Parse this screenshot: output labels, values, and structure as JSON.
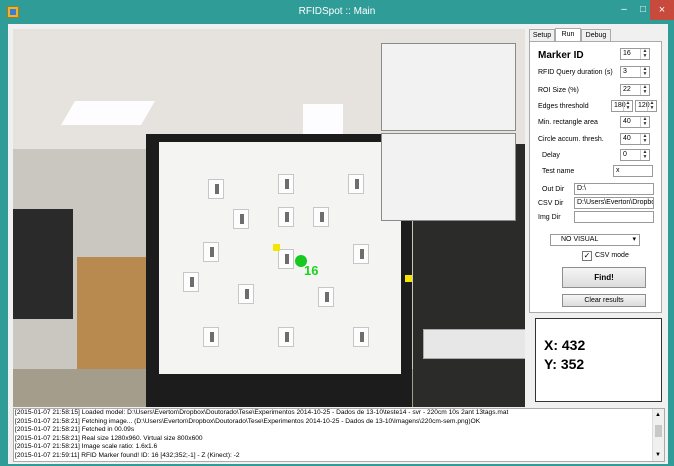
{
  "window": {
    "title": "RFIDSpot :: Main",
    "minimize_glyph": "–",
    "maximize_glyph": "□",
    "close_glyph": "×",
    "colors": {
      "titlebar": "#2f9c98",
      "close": "#c74a3c"
    }
  },
  "tabs": [
    {
      "label": "Setup"
    },
    {
      "label": "Run",
      "active": true
    },
    {
      "label": "Debug"
    }
  ],
  "run_panel": {
    "marker_id_label": "Marker ID",
    "marker_id_value": "16",
    "rfid_query_label": "RFID Query duration (s)",
    "rfid_query_value": "3",
    "roi_size_label": "ROI Size (%)",
    "roi_size_value": "22",
    "edges_threshold_label": "Edges threshold",
    "edges_threshold_value1": "180",
    "edges_threshold_value2": "120",
    "min_rect_area_label": "Min. rectangle area",
    "min_rect_area_value": "40",
    "circle_accum_label": "Circle accum. thresh.",
    "circle_accum_value": "40",
    "delay_label": "Delay",
    "delay_value": "0",
    "test_name_label": "Test name",
    "test_name_value": "x",
    "out_dir_label": "Out Dir",
    "out_dir_value": "D:\\",
    "csv_dir_label": "CSV Dir",
    "csv_dir_value": "D:\\Users\\Everton\\Dropbo",
    "img_dir_label": "Img Dir",
    "img_dir_value": "",
    "visual_select_value": "NO VISUAL",
    "csv_mode_label": "CSV mode",
    "csv_mode_checked": true,
    "find_button": "Find!",
    "clear_button": "Clear results"
  },
  "coords": {
    "x_text": "X: 432",
    "y_text": "Y: 352"
  },
  "overlay": {
    "marker_label": "16"
  },
  "log": [
    "[2015-01-07 21:58:15] Loaded model: D:\\Users\\Everton\\Dropbox\\Doutorado\\Tese\\Experimentos 2014-10-25 - Dados de 13-10\\teste14 - svr - 220cm 10s 2ant 13tags.mat",
    "[2015-01-07 21:58:21] Fetching image... (D:\\Users\\Everton\\Dropbox\\Doutorado\\Tese\\Experimentos 2014-10-25 - Dados de 13-10\\Imagens\\220cm-sem.png)OK",
    "[2015-01-07 21:58:21] Fetched in 00.09s",
    "[2015-01-07 21:58:21] Real size 1280x960. Virtual size 800x600",
    "[2015-01-07 21:58:21] Image scale ratio: 1.6x1.6",
    "[2015-01-07 21:59:11] RFID Marker found! ID: 16 [432;352;-1] - Z (Kinect): -2"
  ]
}
